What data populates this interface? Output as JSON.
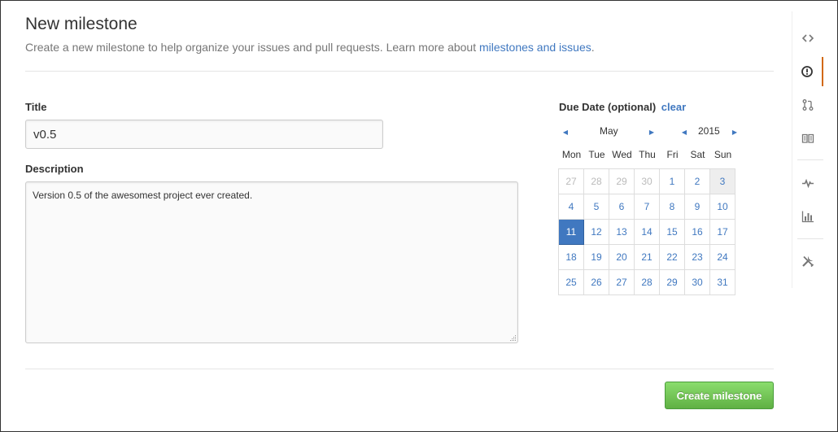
{
  "header": {
    "title": "New milestone",
    "subtitle": "Create a new milestone to help organize your issues and pull requests. Learn more about",
    "subtitle_link": "milestones and issues",
    "subtitle_end": "."
  },
  "form": {
    "title_label": "Title",
    "title_value": "v0.5",
    "description_label": "Description",
    "description_value": "Version 0.5 of the awesomest project ever created."
  },
  "due_date": {
    "label": "Due Date (optional)",
    "clear_link": "clear",
    "month": "May",
    "year": "2015",
    "weekdays": [
      "Mon",
      "Tue",
      "Wed",
      "Thu",
      "Fri",
      "Sat",
      "Sun"
    ],
    "weeks": [
      [
        "27",
        "28",
        "29",
        "30",
        "1",
        "2",
        "3"
      ],
      [
        "4",
        "5",
        "6",
        "7",
        "8",
        "9",
        "10"
      ],
      [
        "11",
        "12",
        "13",
        "14",
        "15",
        "16",
        "17"
      ],
      [
        "18",
        "19",
        "20",
        "21",
        "22",
        "23",
        "24"
      ],
      [
        "25",
        "26",
        "27",
        "28",
        "29",
        "30",
        "31"
      ]
    ],
    "selected_day": "11",
    "today_day": "3"
  },
  "actions": {
    "create_label": "Create milestone"
  },
  "sidebar": {
    "items": [
      {
        "icon": "code-icon",
        "active": false
      },
      {
        "icon": "issue-icon",
        "active": true
      },
      {
        "icon": "pull-request-icon",
        "active": false
      },
      {
        "icon": "wiki-book-icon",
        "active": false
      },
      {
        "icon": "pulse-icon",
        "active": false
      },
      {
        "icon": "graph-icon",
        "active": false
      },
      {
        "icon": "settings-tools-icon",
        "active": false
      }
    ]
  },
  "colors": {
    "link": "#4078c0",
    "active_tab": "#d26911",
    "button_green": "#60b044",
    "selected_day_bg": "#4078c0"
  }
}
